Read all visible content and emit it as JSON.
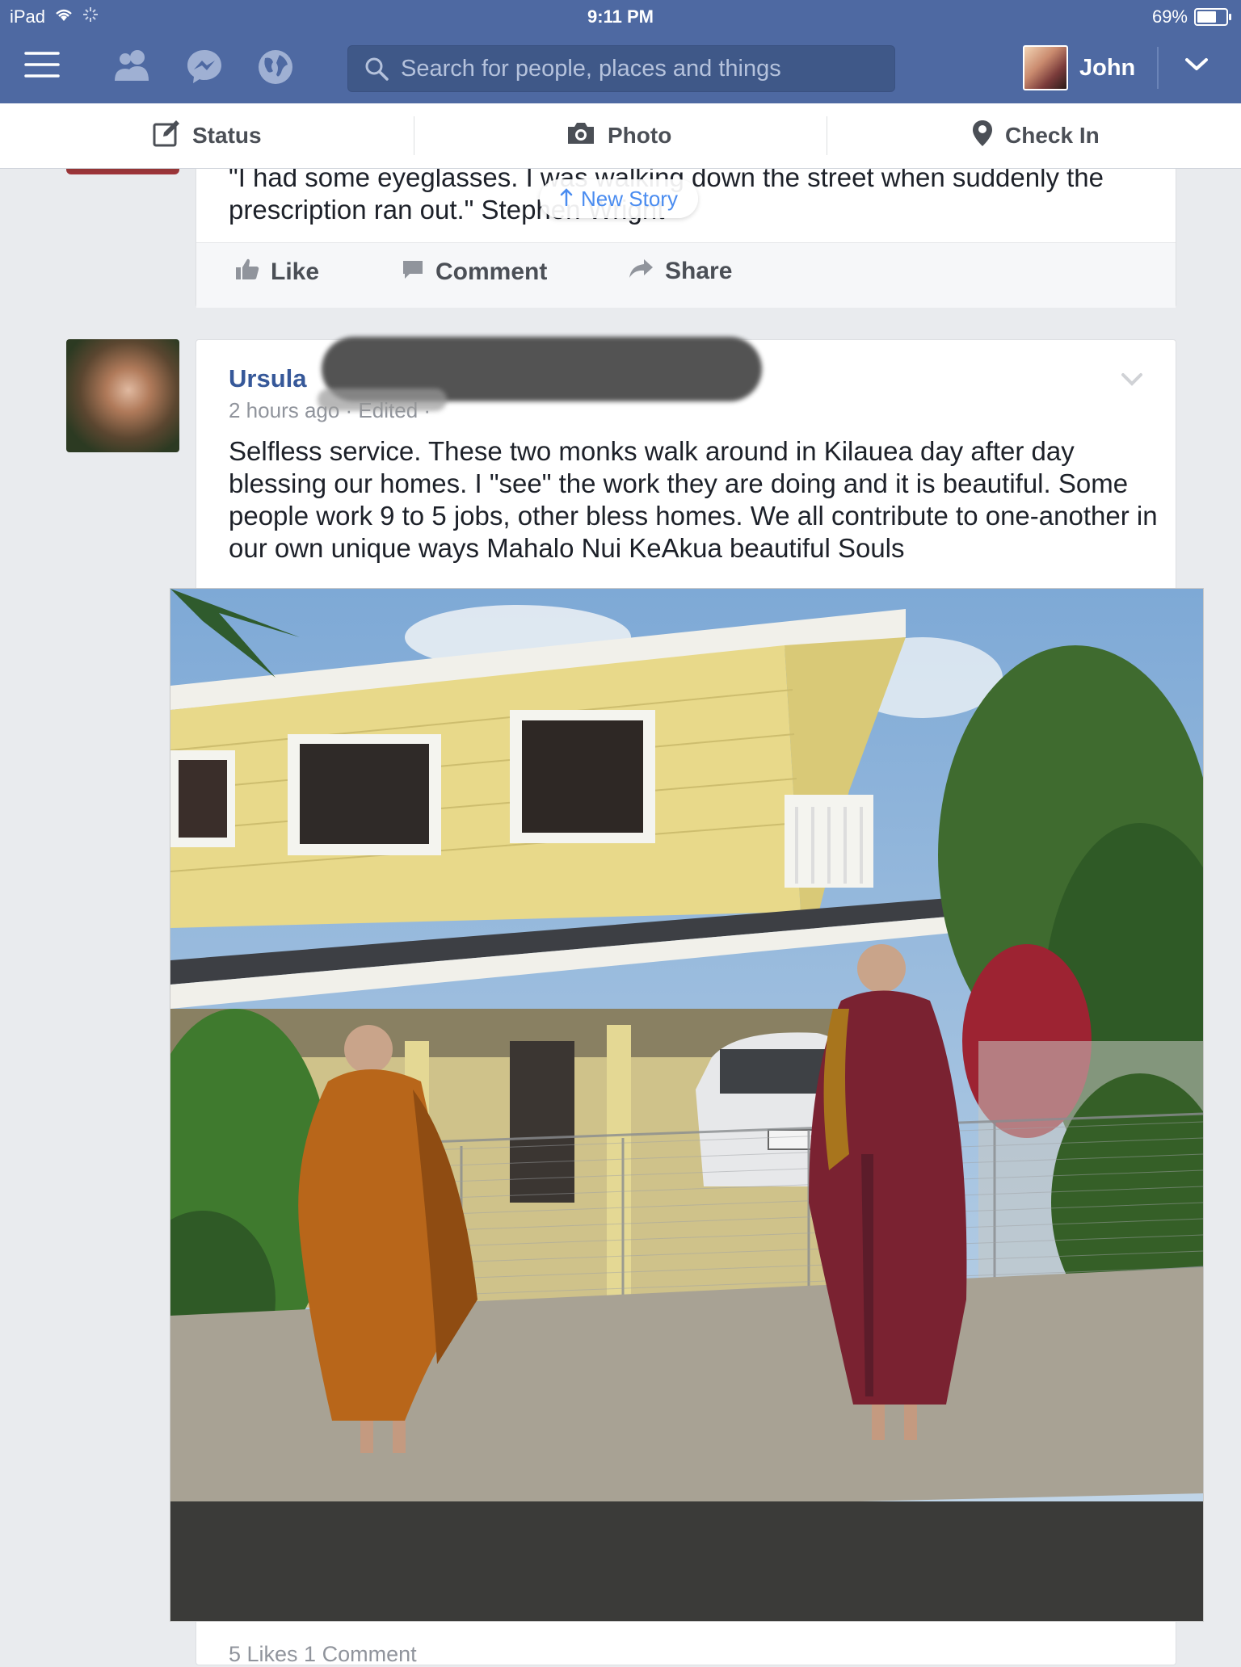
{
  "status_bar": {
    "device": "iPad",
    "time": "9:11 PM",
    "battery": "69%",
    "battery_level": 0.69
  },
  "nav": {
    "search_placeholder": "Search for people, places and things",
    "user_name": "John",
    "icons": [
      "menu-icon",
      "friends-icon",
      "messenger-icon",
      "globe-icon",
      "search-icon",
      "chevron-down-icon"
    ]
  },
  "composer": {
    "status_label": "Status",
    "photo_label": "Photo",
    "checkin_label": "Check In"
  },
  "new_story_label": "New Story",
  "post1": {
    "quote": "\"I had some eyeglasses. I was walking down the street when suddenly the prescription ran out.\"  Stephen Wright",
    "like_label": "Like",
    "comment_label": "Comment",
    "share_label": "Share"
  },
  "post2": {
    "author": "Ursula",
    "time": "2 hours ago · Edited ·",
    "text": "Selfless service. These two monks walk around in Kilauea day after day blessing our homes. I \"see\" the work they are doing and it is beautiful. Some people work 9 to 5 jobs, other bless homes. We all contribute to one-another in our own unique ways Mahalo Nui KeAkua beautiful Souls",
    "stats": "5 Likes  1 Comment"
  },
  "colors": {
    "nav_blue": "#4e69a2",
    "link_blue": "#365899",
    "new_story_blue": "#4a8cf0"
  }
}
